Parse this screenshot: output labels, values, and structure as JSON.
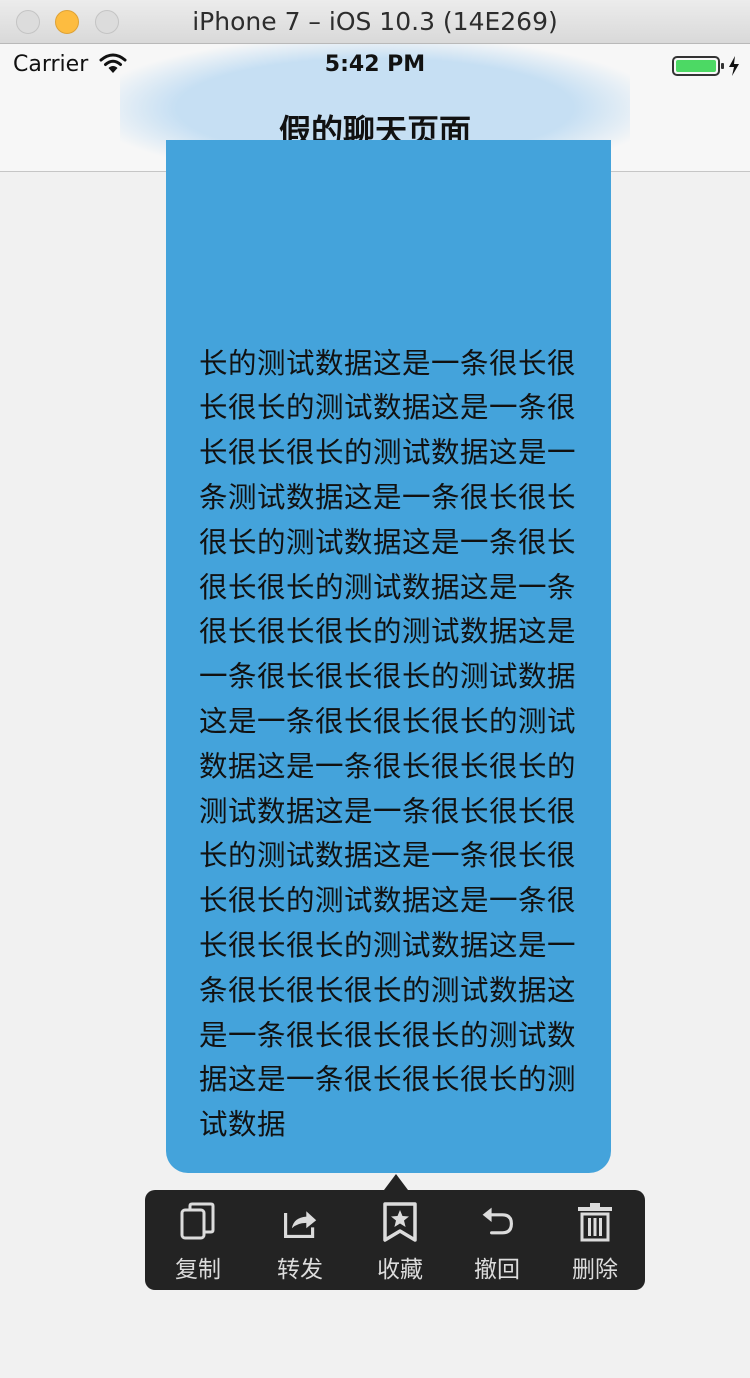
{
  "window": {
    "title": "iPhone 7 – iOS 10.3 (14E269)"
  },
  "status_bar": {
    "carrier": "Carrier",
    "time": "5:42 PM"
  },
  "nav": {
    "title": "假的聊天页面"
  },
  "bubble": {
    "text": "长的测试数据这是一条很长很长很长的测试数据这是一条很长很长很长的测试数据这是一条测试数据这是一条很长很长很长的测试数据这是一条很长很长很长的测试数据这是一条很长很长很长的测试数据这是一条很长很长很长的测试数据这是一条很长很长很长的测试数据这是一条很长很长很长的测试数据这是一条很长很长很长的测试数据这是一条很长很长很长的测试数据这是一条很长很长很长的测试数据这是一条很长很长很长的测试数据这是一条很长很长很长的测试数据这是一条很长很长很长的测试数据",
    "color": "#44a3db"
  },
  "menu": {
    "items": [
      {
        "label": "复制",
        "icon": "copy-icon"
      },
      {
        "label": "转发",
        "icon": "share-icon"
      },
      {
        "label": "收藏",
        "icon": "bookmark-icon"
      },
      {
        "label": "撤回",
        "icon": "undo-icon"
      },
      {
        "label": "删除",
        "icon": "trash-icon"
      }
    ]
  }
}
